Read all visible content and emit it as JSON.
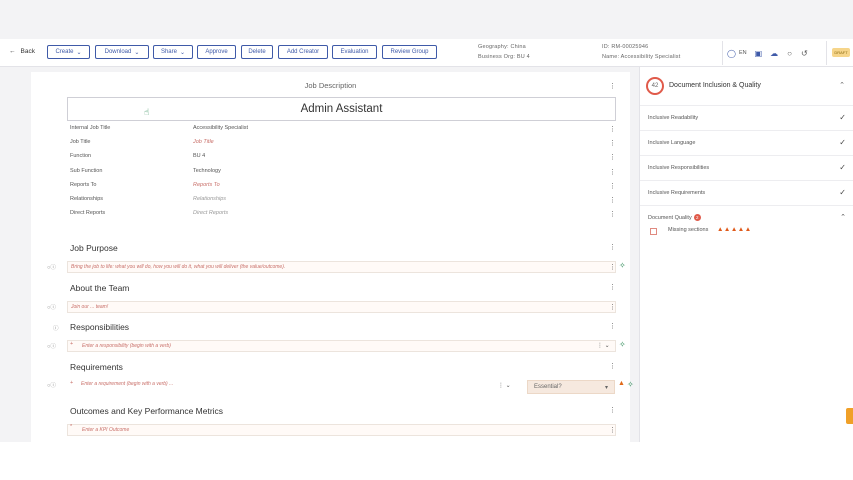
{
  "toolbar": {
    "back_label": "Back",
    "buttons": [
      {
        "label": "Create",
        "dropdown": true
      },
      {
        "label": "Download",
        "dropdown": true
      },
      {
        "label": "Share",
        "dropdown": true
      },
      {
        "label": "Approve",
        "dropdown": false
      },
      {
        "label": "Delete",
        "dropdown": false
      },
      {
        "label": "Add Creator",
        "dropdown": false
      },
      {
        "label": "Evaluation",
        "dropdown": false
      },
      {
        "label": "Review Group",
        "dropdown": false
      }
    ],
    "geography": "Geography: China",
    "business_org": "Business Org: BU 4",
    "id": "ID: RM-00025946",
    "name": "Name: Accessibility Specialist",
    "language": "EN",
    "status_pill": "DRAFT"
  },
  "doc": {
    "heading": "Job Description",
    "job_title": "Admin Assistant",
    "fields": [
      {
        "label": "Internal Job Title",
        "value": "Accessibility Specialist",
        "style": "value"
      },
      {
        "label": "Job Title",
        "value": "Job Title",
        "style": "ph"
      },
      {
        "label": "Function",
        "value": "BU 4",
        "style": "value"
      },
      {
        "label": "Sub Function",
        "value": "Technology",
        "style": "value"
      },
      {
        "label": "Reports To",
        "value": "Reports To",
        "style": "ph"
      },
      {
        "label": "Relationships",
        "value": "Relationships",
        "style": "ph-grey"
      },
      {
        "label": "Direct Reports",
        "value": "Direct Reports",
        "style": "ph-grey"
      }
    ],
    "sections": {
      "job_purpose": {
        "title": "Job Purpose",
        "placeholder": "Bring the job to life: what you will do, how you will do it, what you will deliver (the value/outcome)."
      },
      "about_team": {
        "title": "About the Team",
        "placeholder": "Join our ... team!"
      },
      "responsibilities": {
        "title": "Responsibilities",
        "placeholder": "Enter a responsibility (begin with a verb)"
      },
      "requirements": {
        "title": "Requirements",
        "placeholder": "Enter a requirement (begin with a verb) ...",
        "select_value": "Essential?"
      },
      "outcomes": {
        "title": "Outcomes and Key Performance Metrics",
        "placeholder": "Enter a KPI Outcome"
      }
    }
  },
  "panel": {
    "score": "42",
    "title": "Document Inclusion & Quality",
    "rows": [
      {
        "label": "Inclusive Readability"
      },
      {
        "label": "Inclusive Language"
      },
      {
        "label": "Inclusive Responsibilities"
      },
      {
        "label": "Inclusive Requirements"
      }
    ],
    "quality": {
      "label": "Document Quality",
      "badge": "2",
      "item": "Missing sections"
    }
  },
  "colors": {
    "accent": "#3f5aa8",
    "warning": "#e06a1b",
    "placeholder": "#c9706a",
    "ok": "#2e8b57"
  }
}
